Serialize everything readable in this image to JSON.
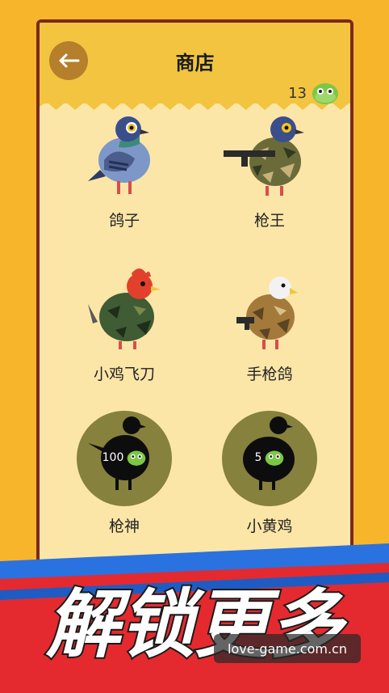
{
  "shop": {
    "title": "商店",
    "coin_count": "13",
    "coin_icon": "green-slime-coin-icon"
  },
  "items": [
    {
      "label": "鸽子",
      "locked": false,
      "icon": "pigeon-icon"
    },
    {
      "label": "枪王",
      "locked": false,
      "icon": "camo-gun-pigeon-icon"
    },
    {
      "label": "小鸡飞刀",
      "locked": false,
      "icon": "rooster-knife-icon"
    },
    {
      "label": "手枪鸽",
      "locked": false,
      "icon": "eagle-pistol-icon"
    },
    {
      "label": "枪神",
      "locked": true,
      "price": "100",
      "icon": "locked-silhouette-icon"
    },
    {
      "label": "小黄鸡",
      "locked": true,
      "price": "5",
      "icon": "locked-silhouette-icon"
    }
  ],
  "banner": {
    "text": "解锁更多",
    "watermark": "love-game.com.cn"
  },
  "colors": {
    "background": "#f7b52c",
    "panel": "#fbe6a8",
    "border": "#7a2a1e",
    "header": "#f2c440",
    "locked_circle": "#86813c",
    "banner_red": "#e42a2f",
    "banner_blue": "#2a72e0"
  }
}
